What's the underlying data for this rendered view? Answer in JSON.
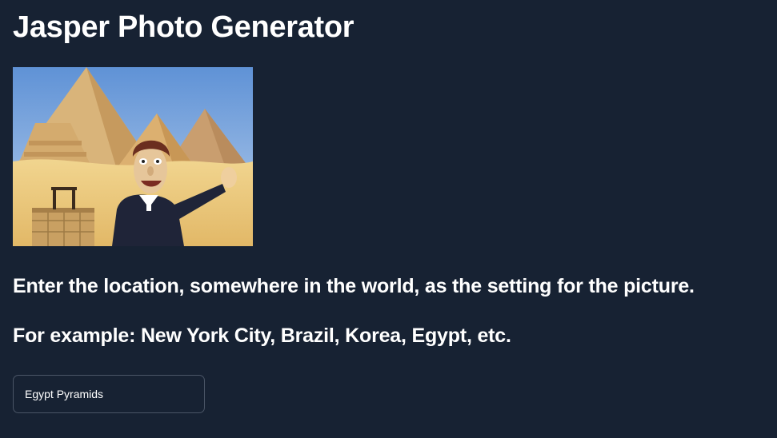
{
  "page": {
    "title": "Jasper Photo Generator"
  },
  "photo": {
    "description_icon": "generated-photo"
  },
  "prompt": {
    "instruction": "Enter the location, somewhere in the world, as the setting for the picture.",
    "example": "For example: New York City, Brazil, Korea, Egypt, etc."
  },
  "location_input": {
    "value": "Egypt Pyramids",
    "placeholder": ""
  },
  "colors": {
    "background": "#172233",
    "text": "#ffffff",
    "input_border": "#4a5566"
  }
}
